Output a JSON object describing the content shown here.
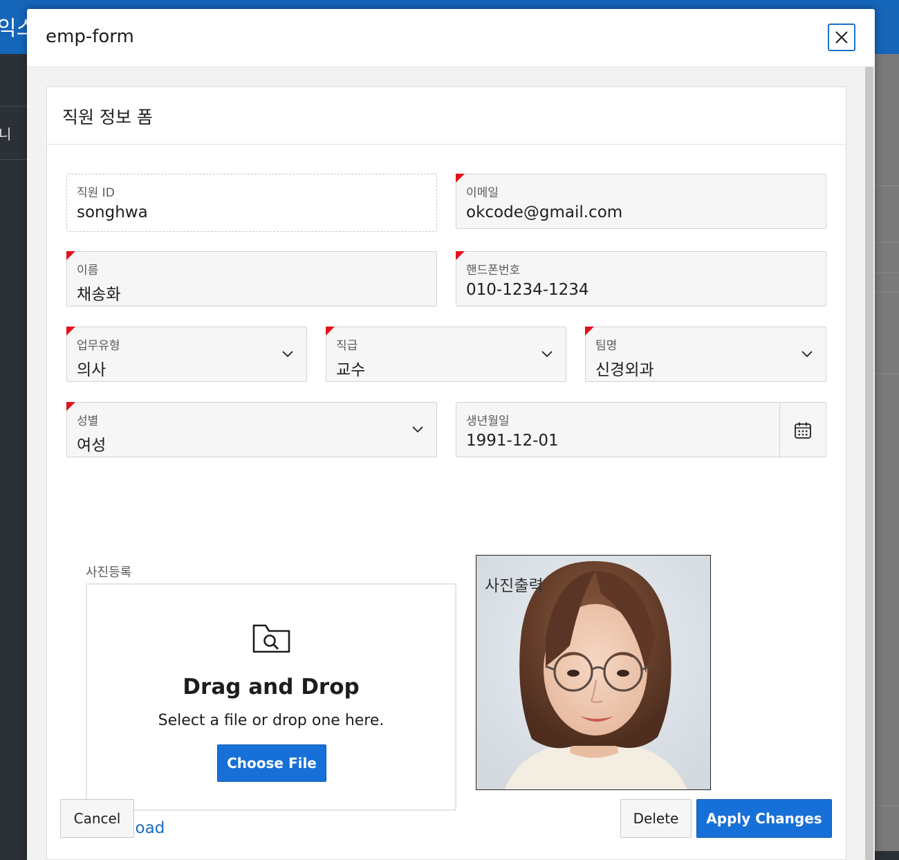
{
  "background": {
    "brand_fragment": "익스",
    "sidebar_fragment": "니"
  },
  "dialog": {
    "title": "emp-form",
    "close_icon": "close-icon"
  },
  "region": {
    "title": "직원 정보 폼"
  },
  "fields": {
    "emp_id": {
      "label": "직원 ID",
      "value": "songhwa",
      "required": false,
      "readonly": true
    },
    "email": {
      "label": "이메일",
      "value": "okcode@gmail.com",
      "required": true
    },
    "name": {
      "label": "이름",
      "value": "채송화",
      "required": true
    },
    "phone": {
      "label": "핸드폰번호",
      "value": "010-1234-1234",
      "required": true
    },
    "job_type": {
      "label": "업무유형",
      "value": "의사",
      "required": true
    },
    "rank": {
      "label": "직급",
      "value": "교수",
      "required": true
    },
    "team": {
      "label": "팀명",
      "value": "신경외과",
      "required": true
    },
    "gender": {
      "label": "성별",
      "value": "여성",
      "required": true
    },
    "birth": {
      "label": "생년월일",
      "value": "1991-12-01",
      "required": false,
      "icon": "calendar-icon"
    }
  },
  "upload": {
    "label": "사진등록",
    "icon": "folder-search-icon",
    "title": "Drag and Drop",
    "subtitle": "Select a file or drop one here.",
    "button": "Choose File",
    "download": "Download"
  },
  "photo": {
    "caption": "사진출력"
  },
  "footer": {
    "cancel": "Cancel",
    "delete": "Delete",
    "apply": "Apply Changes"
  },
  "colors": {
    "accent": "#1770d8",
    "header_bar": "#1565b9",
    "required_flag": "#e5101b",
    "link": "#1b6cc6"
  }
}
